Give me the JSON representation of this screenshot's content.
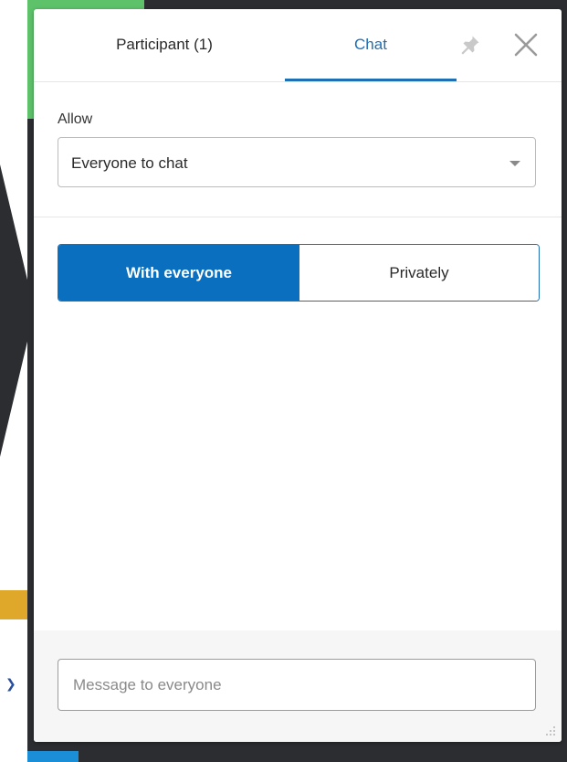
{
  "tabs": {
    "participant_label": "Participant (1)",
    "chat_label": "Chat",
    "active": "Chat"
  },
  "icons": {
    "pin": "pin-icon",
    "close": "close-icon",
    "dropdown": "caret-down-icon",
    "resize": "resize-grip-icon"
  },
  "allow": {
    "label": "Allow",
    "selected": "Everyone to chat"
  },
  "chat_mode": {
    "everyone_label": "With everyone",
    "private_label": "Privately",
    "selected": "With everyone"
  },
  "message": {
    "placeholder": "Message to everyone",
    "value": ""
  },
  "colors": {
    "accent": "#0a6fbe",
    "tab_active": "#1f6fb4"
  }
}
